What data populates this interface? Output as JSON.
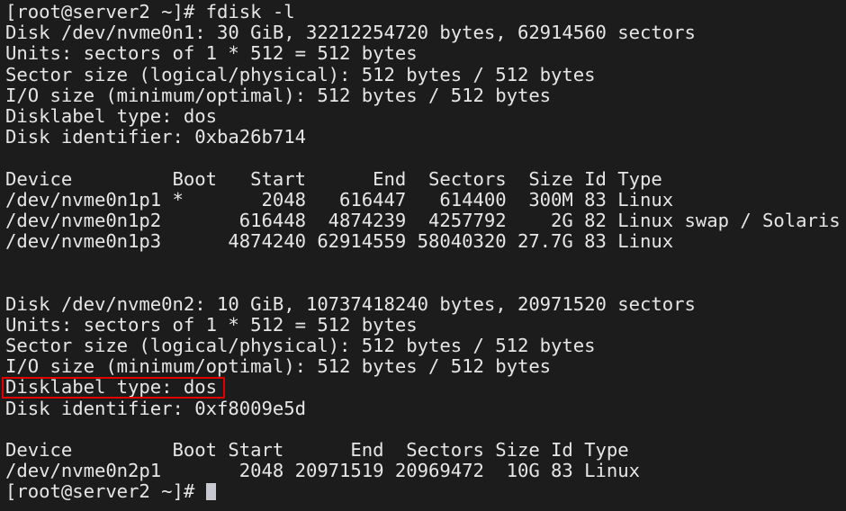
{
  "terminal": {
    "prompt": "[root@server2 ~]# ",
    "command": "fdisk -l",
    "disk1": {
      "header": "Disk /dev/nvme0n1: 30 GiB, 32212254720 bytes, 62914560 sectors",
      "units": "Units: sectors of 1 * 512 = 512 bytes",
      "sector_size": "Sector size (logical/physical): 512 bytes / 512 bytes",
      "io_size": "I/O size (minimum/optimal): 512 bytes / 512 bytes",
      "disklabel": "Disklabel type: dos",
      "identifier": "Disk identifier: 0xba26b714",
      "table_header": "Device         Boot   Start      End  Sectors  Size Id Type",
      "rows": [
        "/dev/nvme0n1p1 *       2048   616447   614400  300M 83 Linux",
        "/dev/nvme0n1p2       616448  4874239  4257792    2G 82 Linux swap / Solaris",
        "/dev/nvme0n1p3      4874240 62914559 58040320 27.7G 83 Linux"
      ]
    },
    "disk2": {
      "header": "Disk /dev/nvme0n2: 10 GiB, 10737418240 bytes, 20971520 sectors",
      "units": "Units: sectors of 1 * 512 = 512 bytes",
      "sector_size": "Sector size (logical/physical): 512 bytes / 512 bytes",
      "io_size": "I/O size (minimum/optimal): 512 bytes / 512 bytes",
      "disklabel": "Disklabel type: dos",
      "identifier": "Disk identifier: 0xf8009e5d",
      "table_header": "Device         Boot Start      End  Sectors Size Id Type",
      "rows": [
        "/dev/nvme0n2p1       2048 20971519 20969472  10G 83 Linux"
      ]
    },
    "highlight_color": "#e00000"
  }
}
